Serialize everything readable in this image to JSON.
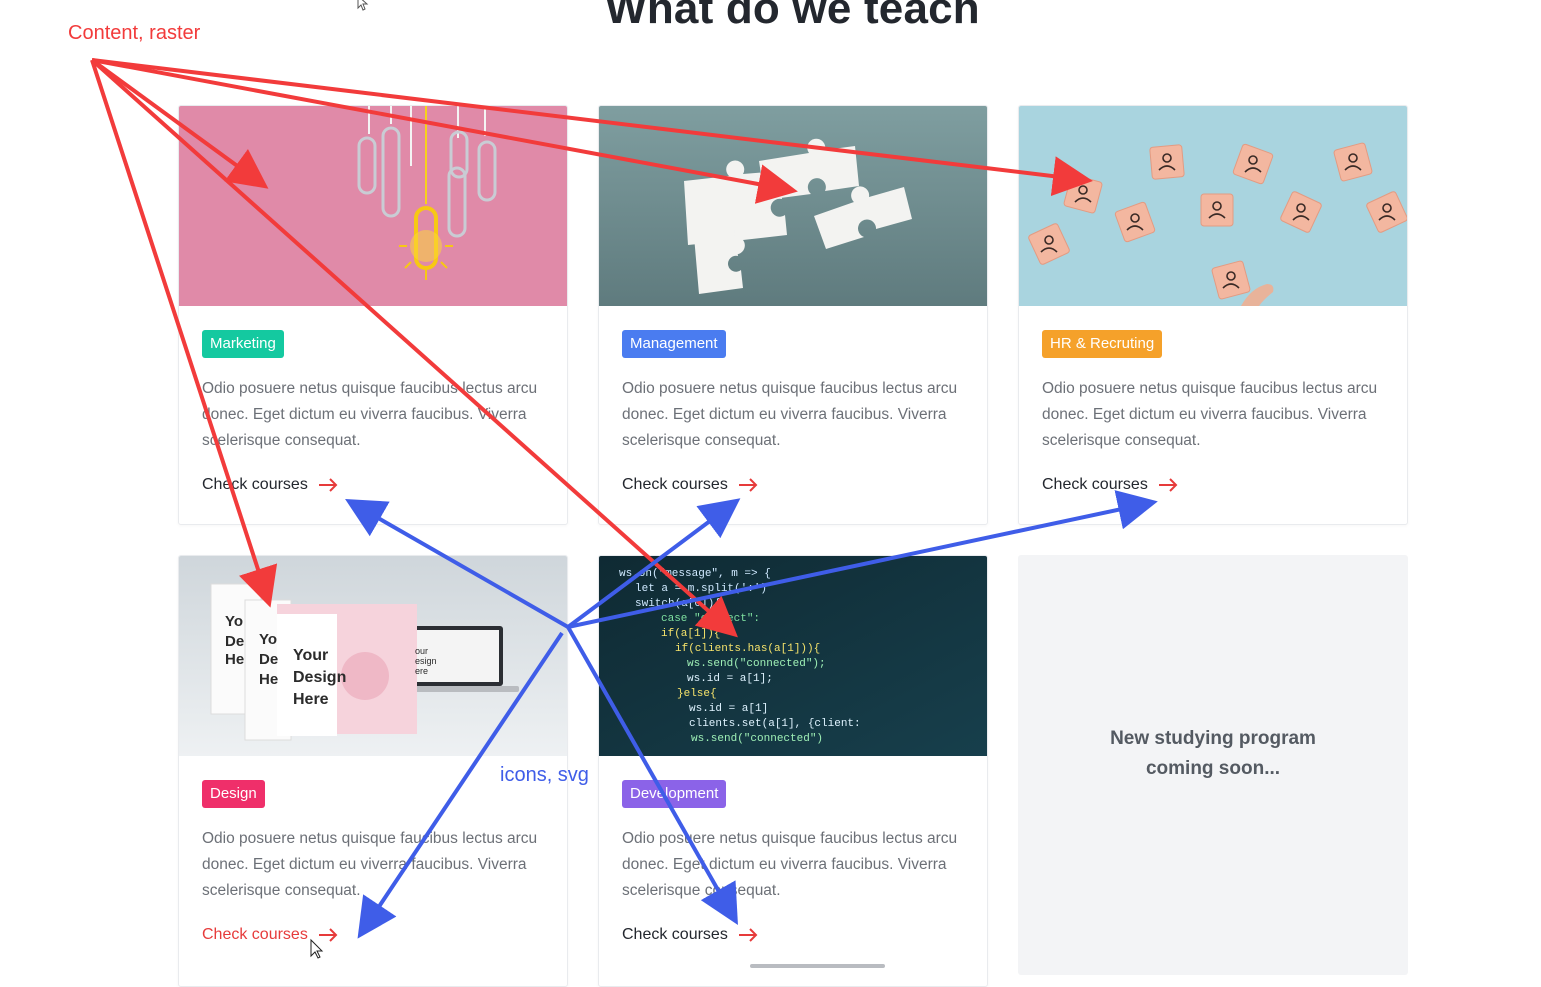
{
  "header": {
    "title": "What do we teach"
  },
  "colors": {
    "marketing": "#14c9a0",
    "management": "#4a7cf0",
    "hr": "#f5a12a",
    "design": "#ef2f6a",
    "development": "#8b63e8",
    "annotation_red": "#f23b3b",
    "annotation_blue": "#3f5de8"
  },
  "cards": [
    {
      "tag": "Marketing",
      "description": "Odio posuere netus quisque faucibus lectus arcu donec. Eget dictum eu viverra faucibus. Viverra scelerisque consequat.",
      "cta": "Check courses",
      "image": "paperclips-lightbulb-image"
    },
    {
      "tag": "Management",
      "description": "Odio posuere netus quisque faucibus lectus arcu donec. Eget dictum eu viverra faucibus. Viverra scelerisque consequat.",
      "cta": "Check courses",
      "image": "puzzle-pieces-image"
    },
    {
      "tag": "HR & Recruting",
      "description": "Odio posuere netus quisque faucibus lectus arcu donec. Eget dictum eu viverra faucibus. Viverra scelerisque consequat.",
      "cta": "Check courses",
      "image": "people-blocks-image"
    },
    {
      "tag": "Design",
      "description": "Odio posuere netus quisque faucibus lectus arcu donec. Eget dictum eu viverra faucibus. Viverra scelerisque consequat.",
      "cta": "Check courses",
      "image": "design-mockups-image",
      "mockup_text": "Your Design Here"
    },
    {
      "tag": "Development",
      "description": "Odio posuere netus quisque faucibus lectus arcu donec. Eget dictum eu viverra faucibus. Viverra scelerisque consequat.",
      "cta": "Check courses",
      "image": "code-screen-image",
      "code_lines": [
        "ws.on(\"message\", m => {",
        "let a = m.split(':')",
        "switch(a[0]){",
        "case \"connect\":",
        "if(a[1]){",
        "if(clients.has(a[1])){",
        "ws.send(\"connected\");",
        "ws.id = a[1];",
        "}else{",
        "ws.id = a[1]",
        "clients.set(a[1], {client:",
        "ws.send(\"connected\")"
      ]
    }
  ],
  "coming_soon": {
    "text": "New studying program coming soon..."
  },
  "annotations": {
    "content_label": "Content, raster",
    "icons_label": "icons, svg"
  }
}
